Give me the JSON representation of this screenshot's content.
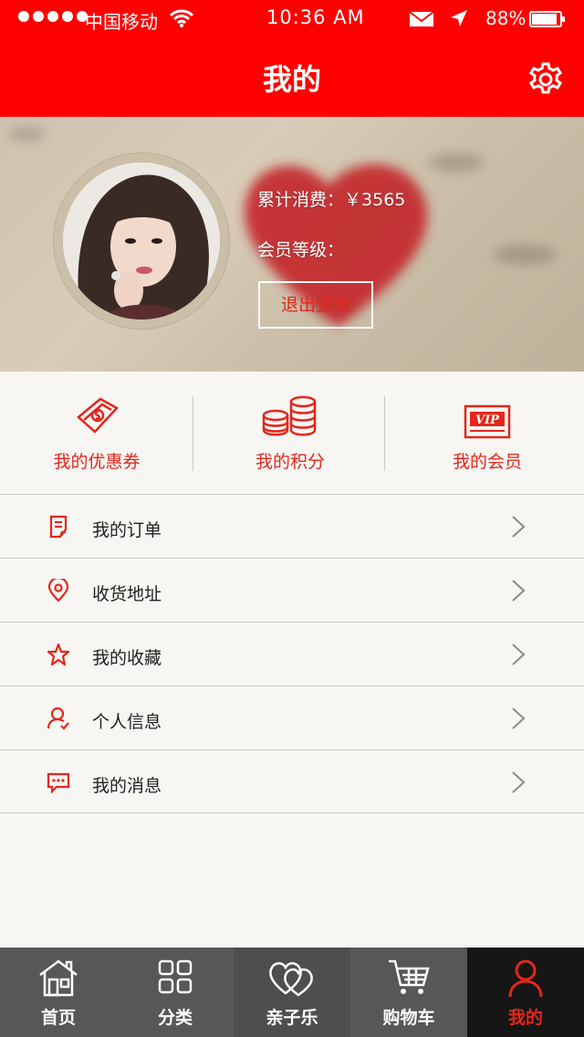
{
  "status": {
    "carrier": "中国移动",
    "time": "10:36 AM",
    "battery": "88%"
  },
  "header": {
    "title": "我的"
  },
  "profile": {
    "total_spend_label": "累计消费：",
    "total_spend_value": "￥3565",
    "member_level_label": "会员等级：",
    "logout_label": "退出登录"
  },
  "quick": [
    {
      "label": "我的优惠券",
      "icon": "coupon-icon"
    },
    {
      "label": "我的积分",
      "icon": "coins-icon"
    },
    {
      "label": "我的会员",
      "icon": "vip-card-icon"
    }
  ],
  "menu": [
    {
      "label": "我的订单",
      "icon": "order-icon"
    },
    {
      "label": "收货地址",
      "icon": "location-pin-icon"
    },
    {
      "label": "我的收藏",
      "icon": "star-icon"
    },
    {
      "label": "个人信息",
      "icon": "user-icon"
    },
    {
      "label": "我的消息",
      "icon": "message-icon"
    }
  ],
  "tabs": [
    {
      "label": "首页",
      "icon": "home-icon"
    },
    {
      "label": "分类",
      "icon": "grid-icon"
    },
    {
      "label": "亲子乐",
      "icon": "hearts-icon"
    },
    {
      "label": "购物车",
      "icon": "cart-icon"
    },
    {
      "label": "我的",
      "icon": "user-icon"
    }
  ],
  "colors": {
    "brand_red": "#ff0000",
    "accent_red": "#e3271c",
    "tabbar": "#575757",
    "tabbar_active": "#161616"
  }
}
